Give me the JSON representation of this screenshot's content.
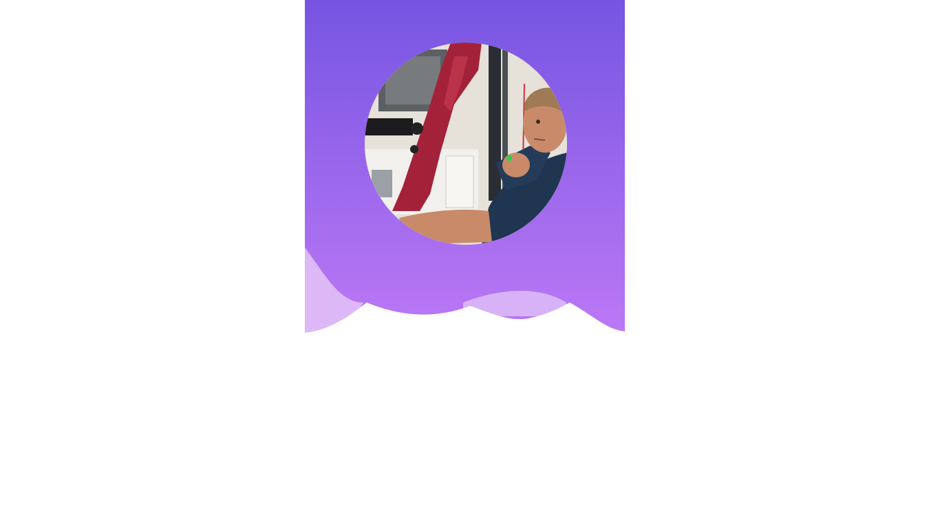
{
  "header": {
    "gradient_top": "#7655e2",
    "gradient_bottom": "#bc78f5",
    "wave_light": "#dcb8f7",
    "wave_mid": "#d6b0f6"
  },
  "profile": {
    "avatar_icon": "profile-photo",
    "photo_description_colors": {
      "bow_riser": "#a3223a",
      "shirt": "#1f3550",
      "skin": "#c98a6a",
      "wall": "#e6e2da"
    }
  }
}
